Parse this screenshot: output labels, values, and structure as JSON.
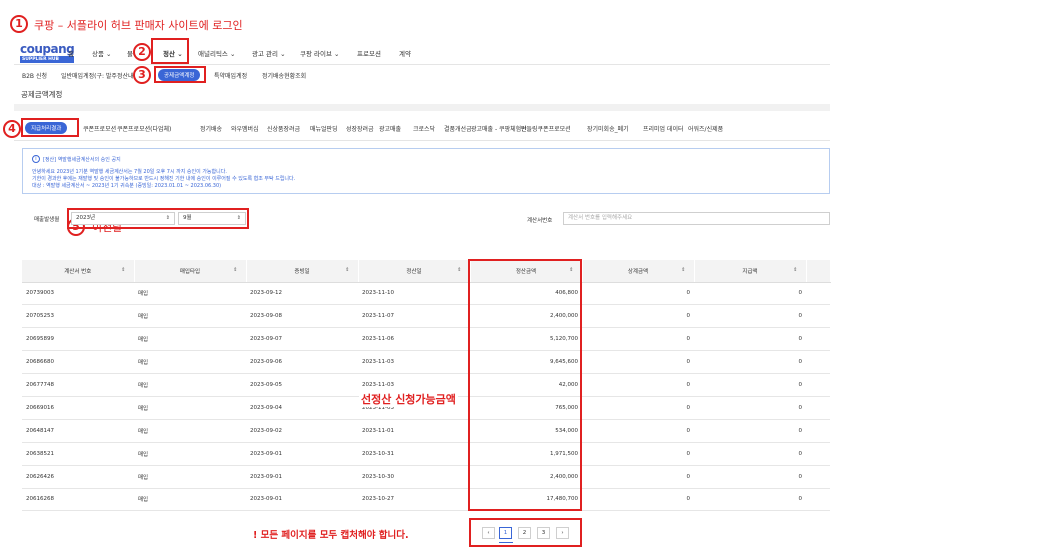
{
  "annotations": {
    "step1": {
      "num": "1",
      "text": "쿠팡 – 서플라이 허브 판매자 사이트에 로그인"
    },
    "step2": {
      "num": "2"
    },
    "step3": {
      "num": "3"
    },
    "step4": {
      "num": "4"
    },
    "step5": {
      "num": "5",
      "text": "이전달"
    },
    "amount_note": "선정산 신청가능금액",
    "capture_note": "! 모든 페이지를 모두 캡처해야 합니다."
  },
  "logo": {
    "main": "coupang",
    "sub": "SUPPLIER HUB"
  },
  "top_menu": [
    "홈",
    "상품",
    "물류",
    "정산",
    "애널리틱스",
    "광고 관리",
    "쿠팡 라이브",
    "프로모션",
    "계약"
  ],
  "sub_menu": {
    "items": [
      "B2B 신청",
      "일반매입계정(구: 발주정산내역)"
    ],
    "active": "공제금액계정",
    "after": [
      "특약매입계정",
      "정기배송현황조회"
    ]
  },
  "page_title": "공제금액계정",
  "deduction_tabs": {
    "active": "지급처리결과",
    "items": [
      "쿠폰프로모션",
      "쿠폰프로모션(다업체)",
      "정기배송",
      "와우멤버십",
      "신상품장려금",
      "매뉴얼판딩",
      "성장장려금",
      "광고매출",
      "크로스닥",
      "결품개선금",
      "광고매출 - 쿠팡체험단",
      "번들링쿠폰프로모션",
      "장기미회송_폐기",
      "프리미엄 데이터",
      "어워즈/신제품"
    ]
  },
  "notice": {
    "icon": "info-circle-icon",
    "title": "[정산] 역발행세금계산서의 승인 공지",
    "lines": [
      "안녕하세요 2023년 1기분 역발행 세금계산서는 7월 20일 오후 7시 까지 승인이 가능합니다.",
      "기한이 경과한 후에는 재발행 및 승인이 불가능하므로 반드시 정해진 기한 내에 승인이 이루어질 수 있도록 협조 부탁 드립니다.",
      "대상 : 역발행 세금계산서 ~ 2023년 1기 귀속분 (증빙일: 2023.01.01 ~ 2023.06.30)"
    ]
  },
  "filters": {
    "date_label": "매출발생월",
    "year": "2023년",
    "month": "9월",
    "invoice_label": "계산서번호",
    "invoice_placeholder": "계산서 번호를 입력해주세요"
  },
  "table": {
    "columns": [
      "계산서 번호",
      "매입타입",
      "증빙일",
      "정산일",
      "정산금액",
      "상계금액",
      "지급액"
    ],
    "rows": [
      [
        "20739003",
        "매입",
        "2023-09-12",
        "2023-11-10",
        "406,800",
        "0",
        "0"
      ],
      [
        "20705253",
        "매입",
        "2023-09-08",
        "2023-11-07",
        "2,400,000",
        "0",
        "0"
      ],
      [
        "20695899",
        "매입",
        "2023-09-07",
        "2023-11-06",
        "5,120,700",
        "0",
        "0"
      ],
      [
        "20686680",
        "매입",
        "2023-09-06",
        "2023-11-03",
        "9,645,600",
        "0",
        "0"
      ],
      [
        "20677748",
        "매입",
        "2023-09-05",
        "2023-11-03",
        "42,000",
        "0",
        "0"
      ],
      [
        "20669016",
        "매입",
        "2023-09-04",
        "2023-11-03",
        "765,000",
        "0",
        "0"
      ],
      [
        "20648147",
        "매입",
        "2023-09-02",
        "2023-11-01",
        "534,000",
        "0",
        "0"
      ],
      [
        "20638521",
        "매입",
        "2023-09-01",
        "2023-10-31",
        "1,971,500",
        "0",
        "0"
      ],
      [
        "20626426",
        "매입",
        "2023-09-01",
        "2023-10-30",
        "2,400,000",
        "0",
        "0"
      ],
      [
        "20616268",
        "매입",
        "2023-09-01",
        "2023-10-27",
        "17,480,700",
        "0",
        "0"
      ]
    ]
  },
  "pagination": {
    "prev": "‹",
    "pages": [
      "1",
      "2",
      "3"
    ],
    "next": "›",
    "active": "1"
  },
  "colors": {
    "accent": "#3a66d6",
    "annotation": "#e02020"
  }
}
